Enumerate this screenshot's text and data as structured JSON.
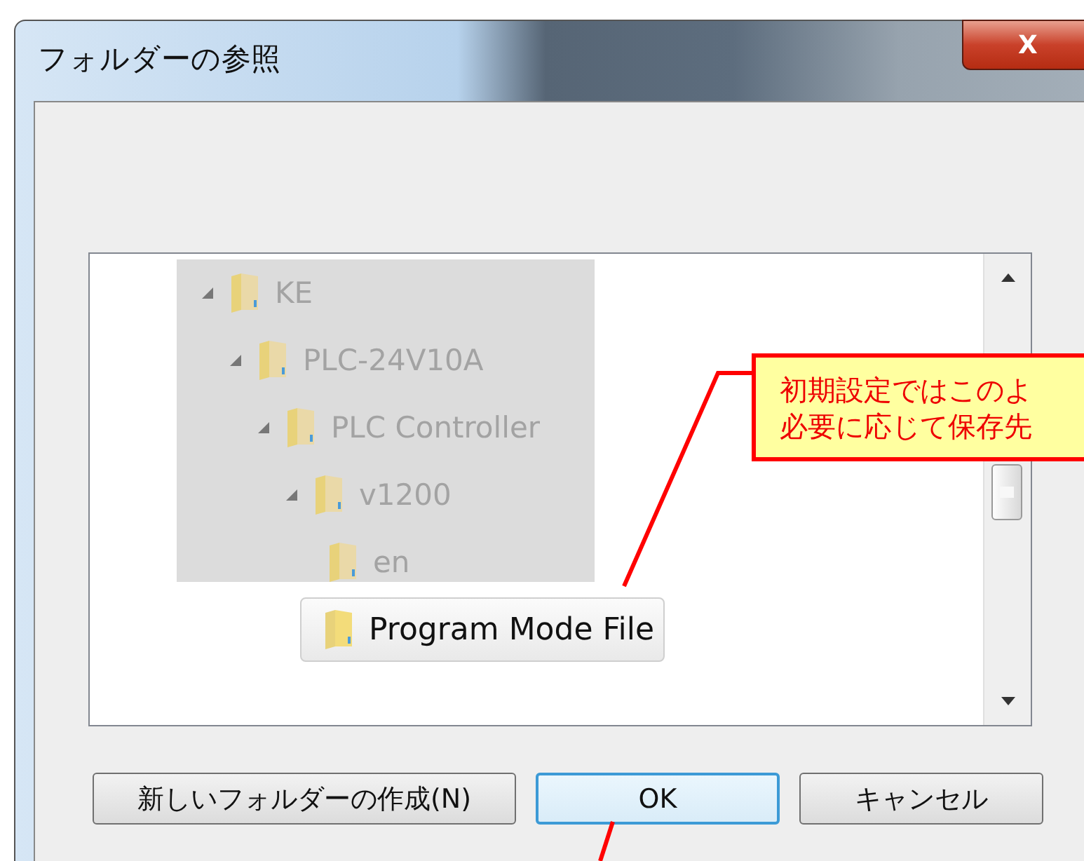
{
  "window": {
    "title": "フォルダーの参照",
    "close_label": "X"
  },
  "tree": [
    {
      "label": "KE",
      "expanded": true,
      "selected": false,
      "children": [
        {
          "label": "PLC-24V10A",
          "expanded": true,
          "selected": false,
          "children": [
            {
              "label": "PLC Controller",
              "expanded": true,
              "selected": false,
              "children": [
                {
                  "label": "v1200",
                  "expanded": true,
                  "selected": false,
                  "children": [
                    {
                      "label": "en",
                      "expanded": false,
                      "selected": false
                    },
                    {
                      "label": "Program Mode File",
                      "expanded": false,
                      "selected": true
                    }
                  ]
                }
              ]
            }
          ]
        }
      ]
    }
  ],
  "callout": {
    "lines": [
      "初期設定ではこのよ",
      "必要に応じて保存先"
    ]
  },
  "buttons": [
    {
      "label": "新しいフォルダーの作成(N)",
      "default": false
    },
    {
      "label": "OK",
      "default": true
    },
    {
      "label": "キャンセル",
      "default": false
    }
  ]
}
